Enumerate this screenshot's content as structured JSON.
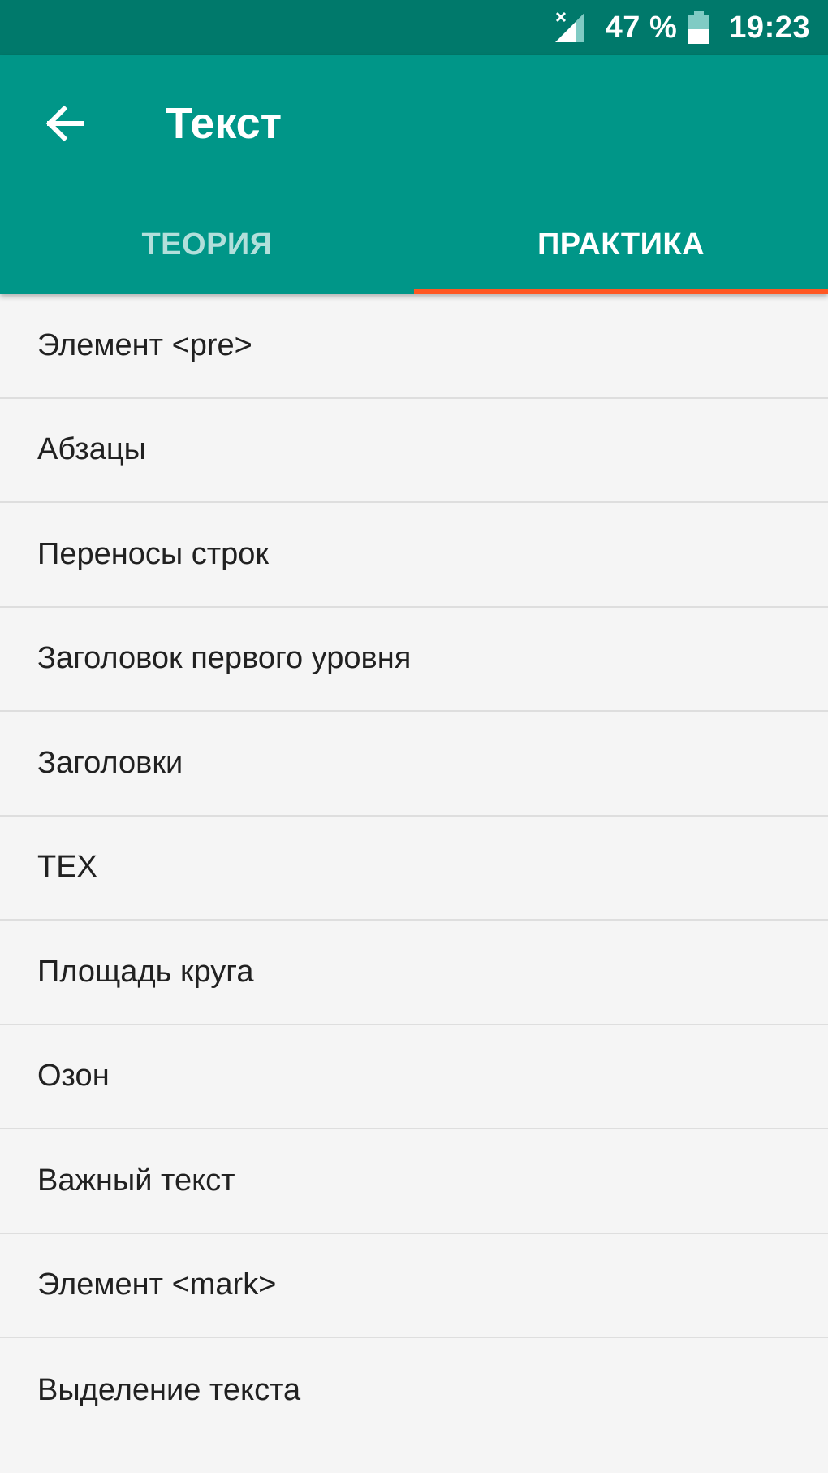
{
  "status_bar": {
    "battery": "47 %",
    "time": "19:23"
  },
  "app_bar": {
    "title": "Текст"
  },
  "tabs": [
    {
      "label": "ТЕОРИЯ",
      "active": false
    },
    {
      "label": "ПРАКТИКА",
      "active": true
    }
  ],
  "items": [
    {
      "label": "Элемент <pre>"
    },
    {
      "label": "Абзацы"
    },
    {
      "label": "Переносы строк"
    },
    {
      "label": "Заголовок первого уровня"
    },
    {
      "label": "Заголовки"
    },
    {
      "label": "TEX"
    },
    {
      "label": "Площадь круга"
    },
    {
      "label": "Озон"
    },
    {
      "label": "Важный текст"
    },
    {
      "label": "Элемент <mark>"
    },
    {
      "label": "Выделение текста"
    }
  ],
  "colors": {
    "status_bar": "#00796b",
    "app_bar": "#009688",
    "tab_indicator": "#ff5722",
    "background": "#f5f5f5"
  }
}
